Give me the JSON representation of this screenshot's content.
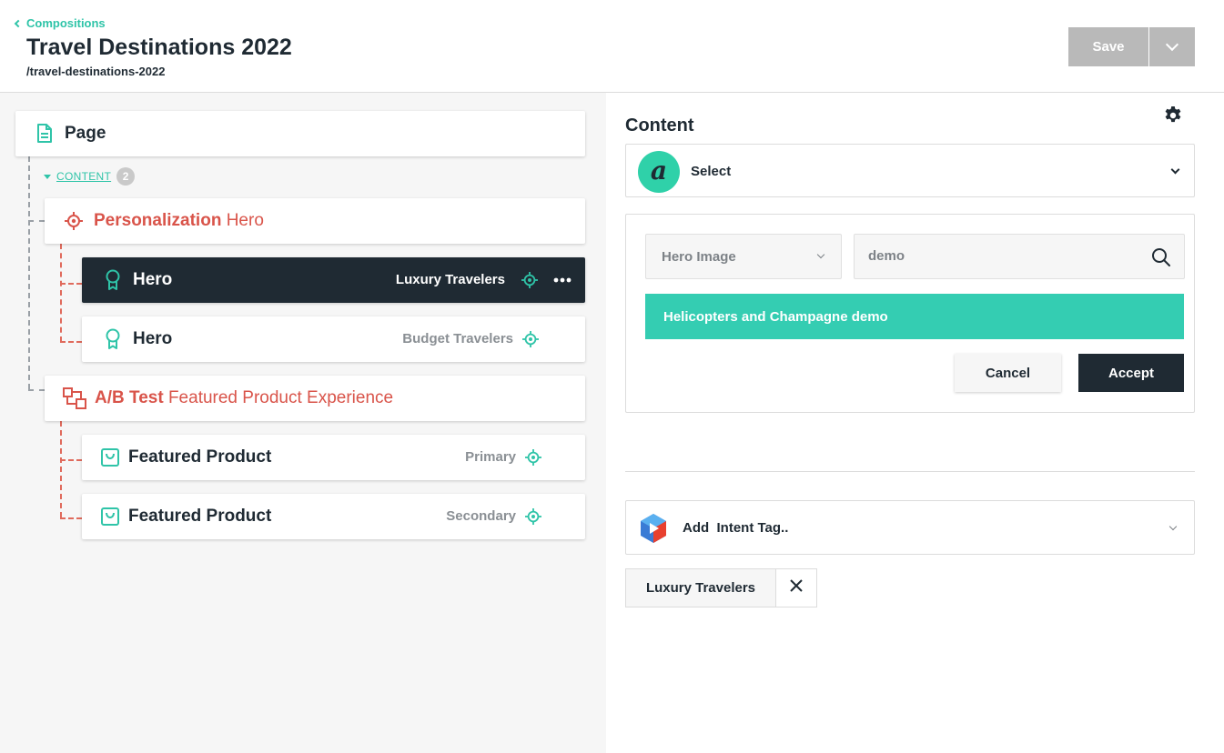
{
  "header": {
    "back_label": "Compositions",
    "title": "Travel Destinations 2022",
    "slug": "/travel-destinations-2022",
    "save_label": "Save"
  },
  "tree": {
    "page_label": "Page",
    "content_toggle_label": "CONTENT",
    "content_count": "2",
    "personalization": {
      "type_label": "Personalization",
      "name": "Hero"
    },
    "hero_items": [
      {
        "label": "Hero",
        "tag": "Luxury Travelers",
        "selected": true
      },
      {
        "label": "Hero",
        "tag": "Budget Travelers",
        "selected": false
      }
    ],
    "ab_test": {
      "type_label": "A/B Test",
      "name": "Featured Product Experience"
    },
    "product_items": [
      {
        "label": "Featured Product",
        "tag": "Primary"
      },
      {
        "label": "Featured Product",
        "tag": "Secondary"
      }
    ]
  },
  "content_panel": {
    "heading": "Content",
    "source_select_label": "Select",
    "type_select_value": "Hero Image",
    "search_value": "demo",
    "result_label": "Helicopters and Champagne demo",
    "cancel_label": "Cancel",
    "accept_label": "Accept"
  },
  "intent": {
    "add_label": "Add  Intent Tag..",
    "chip_label": "Luxury Travelers"
  },
  "colors": {
    "accent": "#2fc4a8",
    "dark": "#1f2a33",
    "personalization_red": "#d9544a",
    "result_bg": "#34cdb2",
    "save_disabled": "#b9b9b9"
  }
}
